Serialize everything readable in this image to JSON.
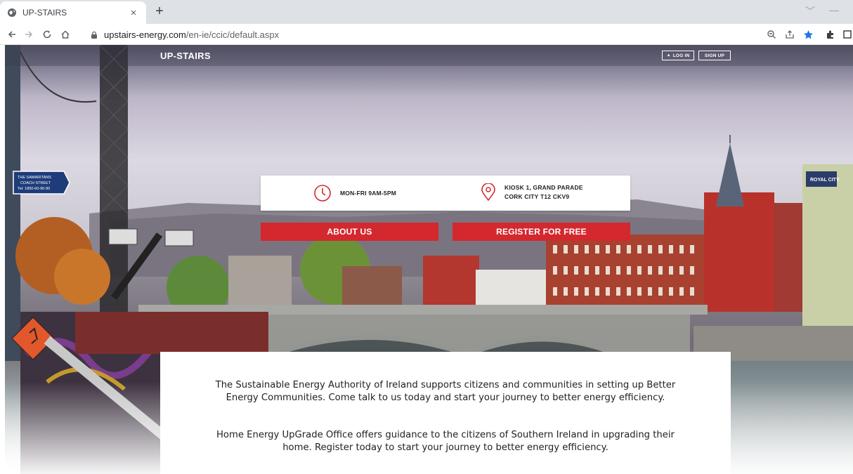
{
  "browser": {
    "tab_title": "UP-STAIRS",
    "tab_close": "×",
    "new_tab": "+",
    "url_host": "upstairs-energy.com",
    "url_path": "/en-ie/ccic/default.aspx",
    "window_controls": {
      "dropdown": "﹀",
      "minimize": "—"
    },
    "icons": [
      "back-icon",
      "forward-icon",
      "reload-icon",
      "home-icon",
      "lock-icon",
      "zoom-icon",
      "share-icon",
      "bookmark-star-icon",
      "extensions-icon",
      "sidepanel-icon"
    ],
    "accent_color": "#1a73e8"
  },
  "site": {
    "brand": "UP-STAIRS",
    "login_label": "LOG IN",
    "signup_label": "SIGN UP"
  },
  "info": {
    "hours": "MON-FRI 9AM-5PM",
    "address_line1": "KIOSK 1, GRAND PARADE",
    "address_line2": "CORK CITY T12 CKV9",
    "icon_color": "#d4282f"
  },
  "buttons": {
    "about": "ABOUT US",
    "register": "REGISTER FOR FREE",
    "color": "#d4282f"
  },
  "content": {
    "paragraph1": "The Sustainable Energy Authority of Ireland supports citizens and communities in setting up Better Energy Communities. Come talk to us today and start your journey to better energy efficiency.",
    "paragraph2": "Home Energy UpGrade Office offers guidance to the citizens of Southern Ireland in upgrading their home. Register today to start your journey to better energy efficiency."
  },
  "hero_signs": {
    "sign_line1": "THE SAMARITANS",
    "sign_line2": "COACH STREET",
    "sign_line3": "Tel: 1850-60-90-90",
    "hotel_sign": "ROYAL CITY"
  }
}
